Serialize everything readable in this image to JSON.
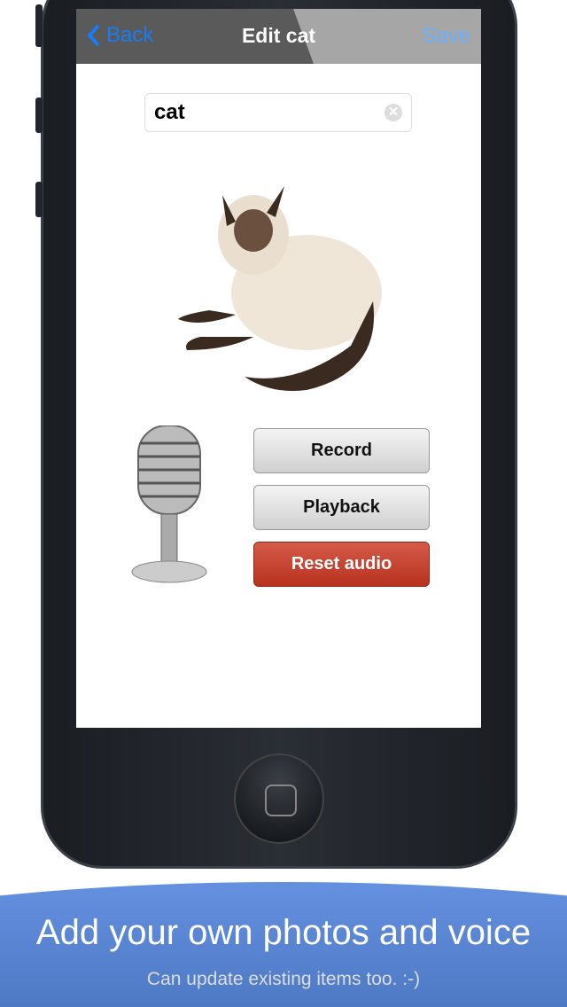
{
  "nav": {
    "back_label": "Back",
    "title": "Edit cat",
    "save_label": "Save"
  },
  "name_field": {
    "value": "cat"
  },
  "buttons": {
    "record": "Record",
    "playback": "Playback",
    "reset": "Reset audio"
  },
  "banner": {
    "headline": "Add your own photos and voice",
    "subtitle": "Can update existing items too.  :-)"
  },
  "colors": {
    "accent": "#1a7cf5",
    "reset": "#c0392b",
    "banner": "#5a86d6"
  }
}
